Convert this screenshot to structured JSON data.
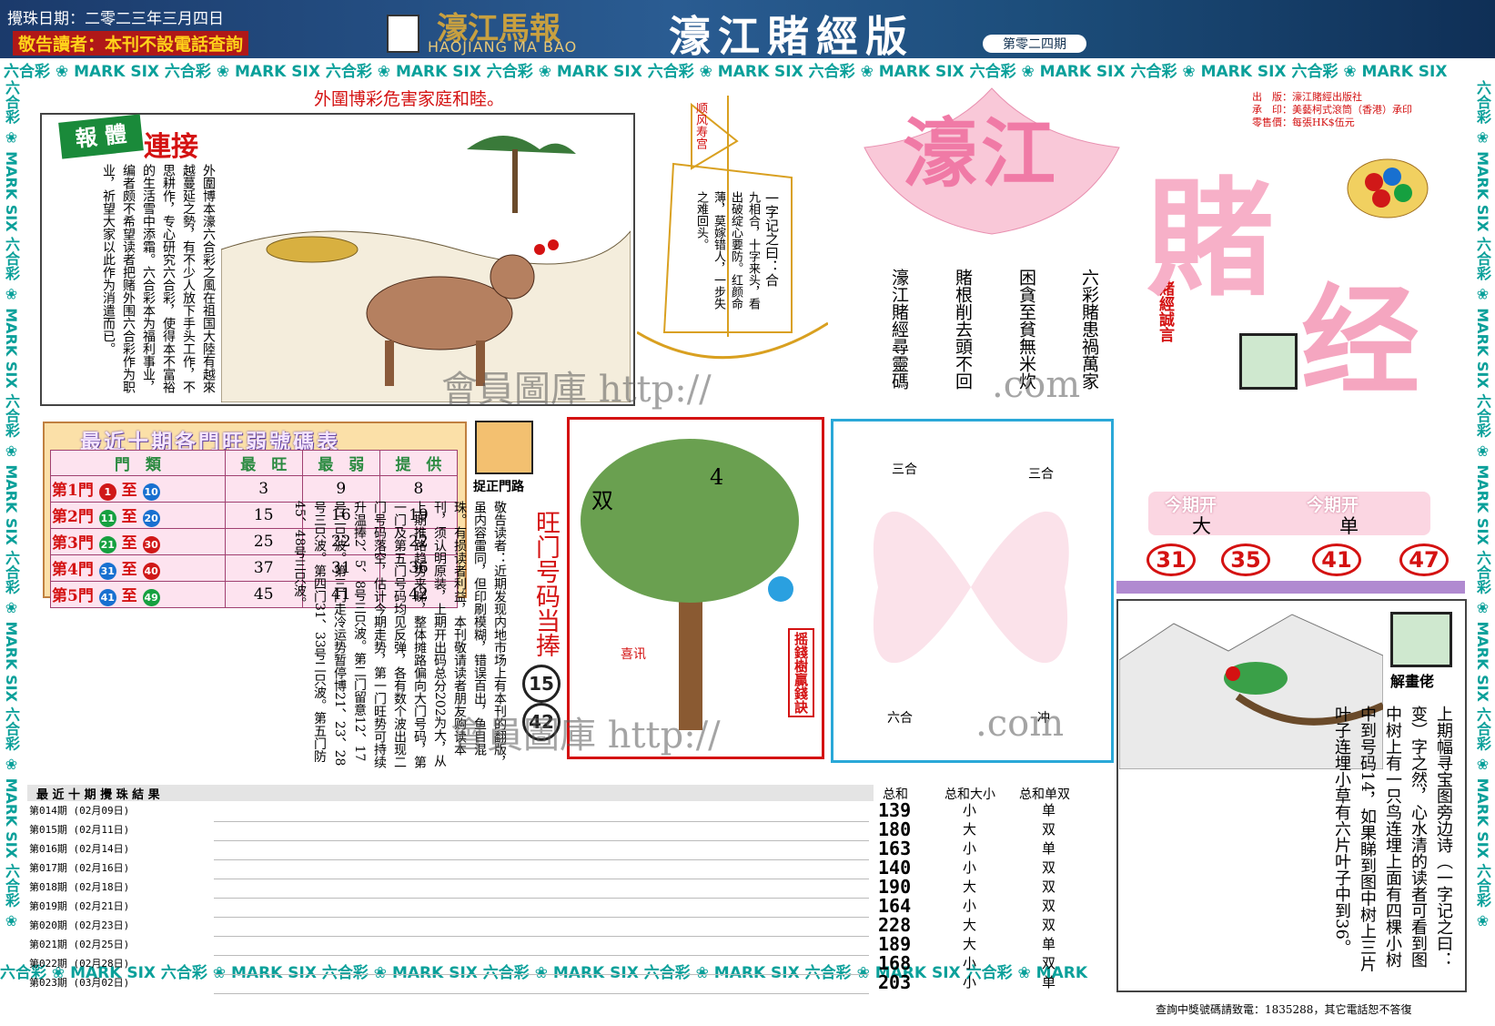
{
  "header": {
    "date": "攪珠日期：二零二三年三月四日",
    "warning": "敬告讀者：本刊不設電話查詢",
    "logo_cn": "濠江馬報",
    "logo_en": "HAOJIANG MA BAO",
    "title": "濠江賭經版",
    "issue": "第零二四期"
  },
  "band_text": "六合彩 ❀ MARK SIX 六合彩 ❀ MARK SIX 六合彩 ❀ MARK SIX 六合彩 ❀ MARK SIX 六合彩 ❀ MARK SIX 六合彩 ❀ MARK SIX 六合彩 ❀ MARK SIX 六合彩 ❀ MARK SIX 六合彩 ❀ MARK SIX",
  "headline": "外圍博彩危害家庭和睦。",
  "lianjie": {
    "label1": "報",
    "label2": "體",
    "label3": "連接",
    "text": "外圍博本濠六合彩之風在祖国大陸有越來越蔓延之勢，有不少人放下手头工作，不思耕作，专心研究六合彩，使得本不富裕的生活雪中添霜。六合彩本为福利事业，编者颇不希望读者把赌外围六合彩作为职业，祈望大家以此作为消遣而已。"
  },
  "ship": {
    "sail": "顺风寿宫",
    "verse_title": "一字记之曰：合",
    "verse": "九相合，十字来头，看出破绽心要防。红颜命薄，莫嫁错人，一步失之难回头。"
  },
  "motto": {
    "lines": [
      "六彩賭患禍萬家",
      "困貪至貧無米炊",
      "賭根削去頭不回",
      "濠江賭經尋靈碼"
    ],
    "label": "賭經誠言"
  },
  "publisher": {
    "line1": "出　版：濠江賭經出版社",
    "line2": "承　印：美藝柯式滾筒（香港）承印",
    "line3": "零售價：每張HK$伍元"
  },
  "bigtitle": {
    "a": "濠江",
    "b": "賭",
    "c": "经"
  },
  "table": {
    "title": "最近十期各門旺弱號碼表",
    "headers": [
      "門　類",
      "最　旺",
      "最　弱",
      "提　供"
    ],
    "rows": [
      {
        "door": "第1門",
        "from": "1",
        "to": "10",
        "hot": "3",
        "cold": "9",
        "tip": "8"
      },
      {
        "door": "第2門",
        "from": "11",
        "to": "20",
        "hot": "15",
        "cold": "16",
        "tip": "19"
      },
      {
        "door": "第3門",
        "from": "21",
        "to": "30",
        "hot": "25",
        "cold": "22",
        "tip": "22"
      },
      {
        "door": "第4門",
        "from": "31",
        "to": "40",
        "hot": "37",
        "cold": "31",
        "tip": "36"
      },
      {
        "door": "第5門",
        "from": "41",
        "to": "49",
        "hot": "45",
        "cold": "41",
        "tip": "42"
      }
    ]
  },
  "door_road": {
    "label": "捉正門路",
    "notice": "敬告读者：近期发现内地市场上有本刊的翻版，虽内容雷同，但印刷模糊，错误百出，鱼目混珠。有损读者利益，本刊敬请读者朋友购读本刊，须认明原装，上期开出码总分202为大，从上期推路趋势来睇，整体摊路偏向大门号码，第一门及第五门号码均见反弹，各有数个波出现二门号码落空，估计今期走势，第一门旺势可持续升温捧2、5、8号三只波。第二门留意12、17号二只波。第三门走冷运势暂停博21、23、28号三只波。第四门31、33号二只波。第五门防45、48号三只波。",
    "hot_label": "旺门号码当捧",
    "hot1": "15",
    "hot2": "42"
  },
  "tree": {
    "label1": "双",
    "label2": "4",
    "side": "摇錢樹贏錢訣",
    "note_title": "喜讯"
  },
  "zodiac": {
    "a": "三合",
    "b": "三合",
    "c": "六合",
    "d": "冲"
  },
  "this_period": {
    "label": "今期开",
    "v1": "大",
    "v2": "单",
    "nums": [
      "31",
      "35",
      "41",
      "47"
    ]
  },
  "jiehua": {
    "label": "解畫佬",
    "text": "上期幅寻宝图旁边诗（一字记之曰：变）字之然，心水清的读者可看到图中树上有一只鸟连埋上面有四棵小树中到号码14，如果睇到图中树上三片叶子连埋小草有六片叶子中到36。"
  },
  "results": {
    "title": "最 近 十 期 攪 珠 結 果",
    "headers": [
      "总和",
      "总和大小",
      "总和单双"
    ],
    "rows": [
      {
        "period": "第014期 (02月09日)",
        "sum": "139",
        "size": "小",
        "parity": "单"
      },
      {
        "period": "第015期 (02月11日)",
        "sum": "180",
        "size": "大",
        "parity": "双"
      },
      {
        "period": "第016期 (02月14日)",
        "sum": "163",
        "size": "小",
        "parity": "单"
      },
      {
        "period": "第017期 (02月16日)",
        "sum": "140",
        "size": "小",
        "parity": "双"
      },
      {
        "period": "第018期 (02月18日)",
        "sum": "190",
        "size": "大",
        "parity": "双"
      },
      {
        "period": "第019期 (02月21日)",
        "sum": "164",
        "size": "小",
        "parity": "双"
      },
      {
        "period": "第020期 (02月23日)",
        "sum": "228",
        "size": "大",
        "parity": "双"
      },
      {
        "period": "第021期 (02月25日)",
        "sum": "189",
        "size": "大",
        "parity": "单"
      },
      {
        "period": "第022期 (02月28日)",
        "sum": "168",
        "size": "小",
        "parity": "双"
      },
      {
        "period": "第023期 (03月02日)",
        "sum": "203",
        "size": "小",
        "parity": "单"
      }
    ]
  },
  "footer": {
    "phone": "查詢中獎號碼請致電：1835288，其它電話恕不答復"
  },
  "watermarks": {
    "w1": "會員圖庫 http://",
    "w2": ".com",
    "w3": "會員圖庫 http://",
    "w4": ".com"
  }
}
